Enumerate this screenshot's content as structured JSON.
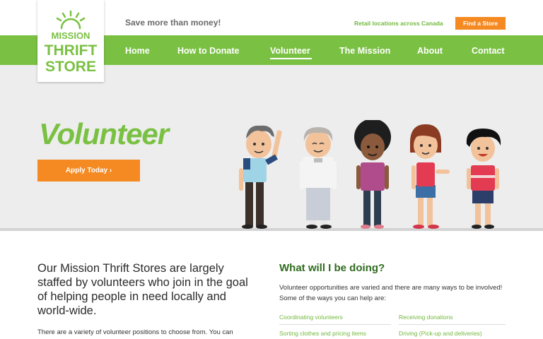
{
  "logo": {
    "line1": "MISSION",
    "line2": "THRIFT",
    "line3": "STORE"
  },
  "header": {
    "tagline": "Save more than money!",
    "retail_link": "Retail locations across Canada",
    "find_store": "Find a Store"
  },
  "nav": {
    "items": [
      {
        "label": "Home"
      },
      {
        "label": "How to Donate"
      },
      {
        "label": "Volunteer"
      },
      {
        "label": "The Mission"
      },
      {
        "label": "About"
      },
      {
        "label": "Contact"
      }
    ],
    "active": "Volunteer"
  },
  "hero": {
    "title": "Volunteer",
    "cta": "Apply Today ›"
  },
  "content": {
    "lede": "Our Mission Thrift Stores are largely staffed by volunteers who join in the goal of helping people in need locally and world-wide.",
    "body": "There are a variety of volunteer positions to choose from. You can",
    "what_heading": "What will I be doing?",
    "what_intro": "Volunteer opportunities are varied and there are many ways to be involved! Some of the ways you can help are:",
    "ways": [
      "Coordinating volunteers",
      "Receiving donations",
      "Sorting clothes and pricing items",
      "Driving (Pick-up and deliveries)"
    ]
  },
  "colors": {
    "brand_green": "#7ac143",
    "dark_green": "#2f6b1f",
    "accent_orange": "#f58a22",
    "hero_bg": "#ededed"
  }
}
